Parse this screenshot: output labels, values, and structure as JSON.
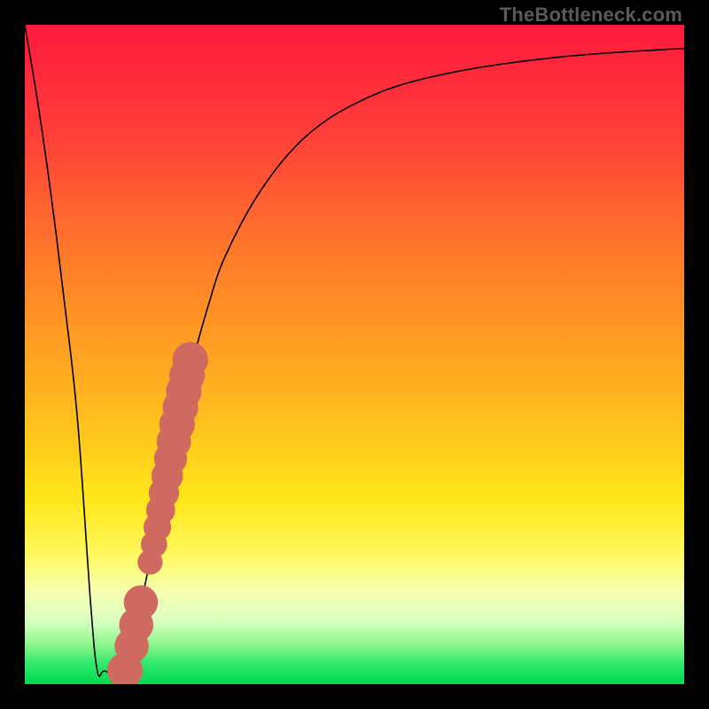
{
  "watermark": "TheBottleneck.com",
  "gradient": {
    "stops": [
      {
        "offset": 0.0,
        "color": "#ff1a3c"
      },
      {
        "offset": 0.15,
        "color": "#ff3a3a"
      },
      {
        "offset": 0.35,
        "color": "#ff7a2a"
      },
      {
        "offset": 0.55,
        "color": "#ffb020"
      },
      {
        "offset": 0.72,
        "color": "#ffe61a"
      },
      {
        "offset": 0.8,
        "color": "#fff85a"
      },
      {
        "offset": 0.86,
        "color": "#f7ffb0"
      },
      {
        "offset": 0.905,
        "color": "#d8ffc0"
      },
      {
        "offset": 0.94,
        "color": "#8cf58c"
      },
      {
        "offset": 0.97,
        "color": "#2fe86a"
      },
      {
        "offset": 1.0,
        "color": "#00d850"
      }
    ]
  },
  "chart_data": {
    "type": "line",
    "title": "",
    "xlabel": "",
    "ylabel": "",
    "xlim": [
      0,
      100
    ],
    "ylim": [
      0,
      100
    ],
    "series": [
      {
        "name": "bottleneck-curve",
        "x": [
          0,
          2,
          4,
          6,
          8,
          10,
          11,
          12,
          14,
          16,
          18,
          20,
          22,
          24,
          26,
          28,
          30,
          34,
          38,
          42,
          46,
          50,
          55,
          60,
          66,
          72,
          80,
          88,
          96,
          100
        ],
        "y": [
          100,
          88,
          74,
          58,
          40,
          12,
          2,
          2,
          2,
          6,
          14,
          24,
          34,
          43,
          51,
          58,
          64,
          72,
          78,
          82.5,
          85.7,
          88,
          90.2,
          91.7,
          93,
          94,
          95,
          95.7,
          96.2,
          96.4
        ]
      }
    ],
    "markers": [
      {
        "name": "marker-cluster",
        "x": 19.0,
        "y": 18.5,
        "r": 1.9
      },
      {
        "name": "marker-cluster",
        "x": 19.6,
        "y": 21.2,
        "r": 2.0
      },
      {
        "name": "marker-cluster",
        "x": 20.1,
        "y": 23.8,
        "r": 2.1
      },
      {
        "name": "marker-cluster",
        "x": 20.6,
        "y": 26.4,
        "r": 2.2
      },
      {
        "name": "marker-cluster",
        "x": 21.1,
        "y": 29.0,
        "r": 2.3
      },
      {
        "name": "marker-cluster",
        "x": 21.6,
        "y": 31.6,
        "r": 2.4
      },
      {
        "name": "marker-cluster",
        "x": 22.1,
        "y": 34.2,
        "r": 2.5
      },
      {
        "name": "marker-cluster",
        "x": 22.6,
        "y": 36.8,
        "r": 2.6
      },
      {
        "name": "marker-cluster",
        "x": 23.1,
        "y": 39.4,
        "r": 2.7
      },
      {
        "name": "marker-cluster",
        "x": 23.6,
        "y": 42.0,
        "r": 2.7
      },
      {
        "name": "marker-cluster",
        "x": 24.1,
        "y": 44.4,
        "r": 2.7
      },
      {
        "name": "marker-cluster",
        "x": 24.6,
        "y": 46.8,
        "r": 2.7
      },
      {
        "name": "marker-cluster",
        "x": 25.1,
        "y": 49.2,
        "r": 2.7
      },
      {
        "name": "marker-low-1",
        "x": 17.6,
        "y": 12.4,
        "r": 2.6
      },
      {
        "name": "marker-low-2",
        "x": 16.9,
        "y": 9.0,
        "r": 2.6
      },
      {
        "name": "marker-low-3",
        "x": 16.2,
        "y": 5.8,
        "r": 2.6
      },
      {
        "name": "marker-bottom",
        "x": 15.2,
        "y": 2.1,
        "r": 2.7
      }
    ],
    "marker_color": "#cf6a60",
    "curve_color": "#000000"
  }
}
